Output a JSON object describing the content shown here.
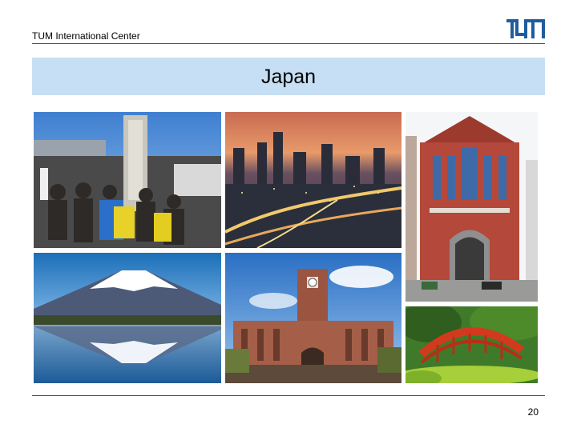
{
  "header": {
    "org_name": "TUM International Center",
    "logo_alt": "TUM"
  },
  "slide": {
    "title": "Japan",
    "page_number": "20"
  },
  "photos": [
    {
      "name": "mount-fuji-summit-group"
    },
    {
      "name": "tokyo-skyline-dusk"
    },
    {
      "name": "keio-university-library"
    },
    {
      "name": "mount-fuji-lake-reflection"
    },
    {
      "name": "university-of-tokyo-yasuda-hall"
    },
    {
      "name": "red-arched-bridge-garden"
    }
  ]
}
